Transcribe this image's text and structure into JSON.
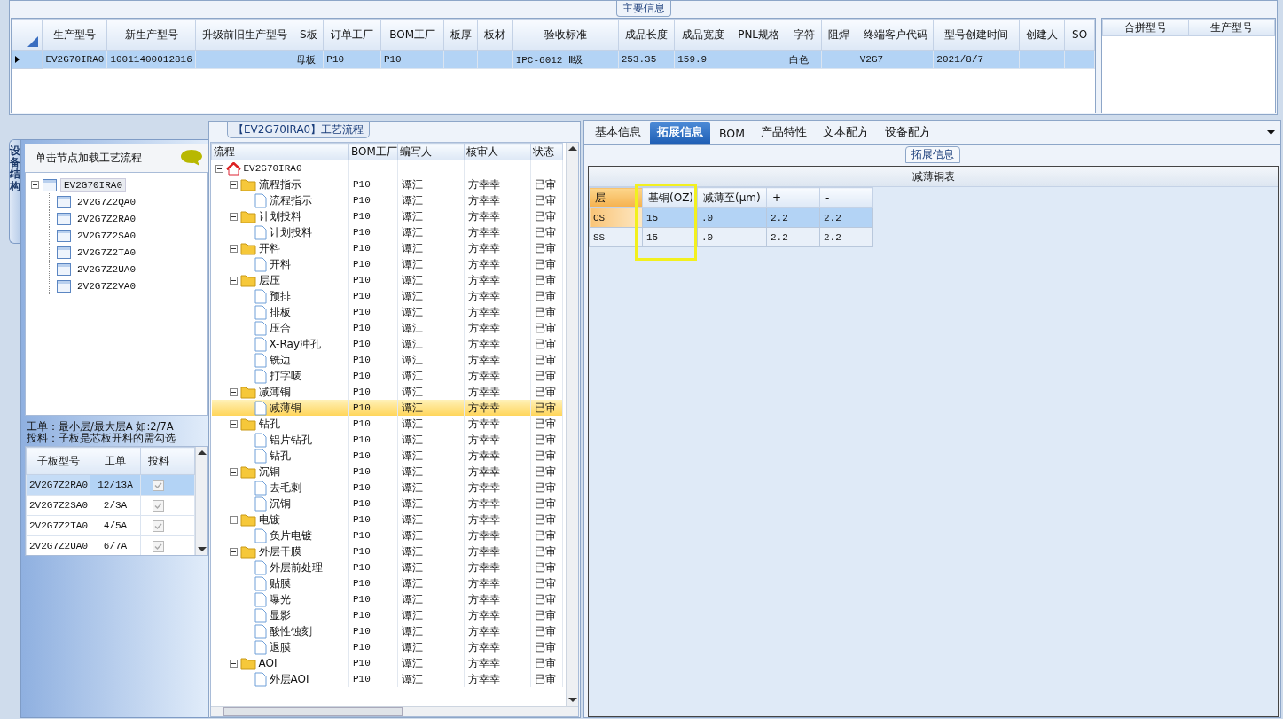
{
  "main_info": {
    "title": "主要信息",
    "columns": [
      "生产型号",
      "新生产型号",
      "升级前旧生产型号",
      "S板",
      "订单工厂",
      "BOM工厂",
      "板厚",
      "板材",
      "验收标准",
      "成品长度",
      "成品宽度",
      "PNL规格",
      "字符",
      "阻焊",
      "终端客户代码",
      "型号创建时间",
      "创建人",
      "SO"
    ],
    "rows": [
      {
        "selected": true,
        "cells": [
          "EV2G70IRA0",
          "10011400012816",
          null,
          "母板",
          "P10",
          "P10",
          null,
          null,
          "IPC-6012 Ⅱ级",
          "253.35",
          "159.9",
          null,
          "白色",
          null,
          "V2G7",
          "2021/8/7",
          null,
          null
        ]
      }
    ],
    "merge_columns": [
      "合拼型号",
      "生产型号"
    ]
  },
  "structure": {
    "tab_label": "设备结构",
    "hint": "单击节点加载工艺流程",
    "tree": {
      "label": "EV2G70IRA0",
      "selected": true,
      "expanded": true,
      "children": [
        {
          "label": "2V2G7Z2QA0",
          "selected": false
        },
        {
          "label": "2V2G7Z2RA0",
          "selected": false
        },
        {
          "label": "2V2G7Z2SA0",
          "selected": false
        },
        {
          "label": "2V2G7Z2TA0",
          "selected": false
        },
        {
          "label": "2V2G7Z2UA0",
          "selected": false
        },
        {
          "label": "2V2G7Z2VA0",
          "selected": false
        }
      ]
    },
    "notes": [
      "工单：最小层/最大层A 如:2/7A",
      "投料：子板是芯板开料的需勾选"
    ],
    "sub_columns": [
      "子板型号",
      "工单",
      "投料"
    ],
    "sub_rows": [
      {
        "model": "2V2G7Z2RA0",
        "order": "12/13A",
        "checked": true,
        "disabled": true,
        "selected": true
      },
      {
        "model": "2V2G7Z2SA0",
        "order": "2/3A",
        "checked": true,
        "disabled": true,
        "selected": false
      },
      {
        "model": "2V2G7Z2TA0",
        "order": "4/5A",
        "checked": true,
        "disabled": true,
        "selected": false
      },
      {
        "model": "2V2G7Z2UA0",
        "order": "6/7A",
        "checked": true,
        "disabled": true,
        "selected": false
      }
    ]
  },
  "flow": {
    "title": "【EV2G70IRA0】工艺流程",
    "columns": [
      "流程",
      "BOM工厂",
      "编写人",
      "核审人",
      "状态"
    ],
    "tree": {
      "label": "EV2G70IRA0",
      "kind": "root",
      "selected": false,
      "expanded": true,
      "children": [
        {
          "label": "流程指示",
          "kind": "folder",
          "bom": "P10",
          "writer": "谭江",
          "reviewer": "方幸幸",
          "status": "已审",
          "selected": false,
          "expanded": true,
          "children": [
            {
              "label": "流程指示",
              "kind": "step",
              "bom": "P10",
              "writer": "谭江",
              "reviewer": "方幸幸",
              "status": "已审",
              "selected": false
            }
          ]
        },
        {
          "label": "计划投料",
          "kind": "folder",
          "bom": "P10",
          "writer": "谭江",
          "reviewer": "方幸幸",
          "status": "已审",
          "selected": false,
          "expanded": true,
          "children": [
            {
              "label": "计划投料",
              "kind": "step",
              "bom": "P10",
              "writer": "谭江",
              "reviewer": "方幸幸",
              "status": "已审",
              "selected": false
            }
          ]
        },
        {
          "label": "开料",
          "kind": "folder",
          "bom": "P10",
          "writer": "谭江",
          "reviewer": "方幸幸",
          "status": "已审",
          "selected": false,
          "expanded": true,
          "children": [
            {
              "label": "开料",
              "kind": "step",
              "bom": "P10",
              "writer": "谭江",
              "reviewer": "方幸幸",
              "status": "已审",
              "selected": false
            }
          ]
        },
        {
          "label": "层压",
          "kind": "folder",
          "bom": "P10",
          "writer": "谭江",
          "reviewer": "方幸幸",
          "status": "已审",
          "selected": false,
          "expanded": true,
          "children": [
            {
              "label": "预排",
              "kind": "step",
              "bom": "P10",
              "writer": "谭江",
              "reviewer": "方幸幸",
              "status": "已审",
              "selected": false
            },
            {
              "label": "排板",
              "kind": "step",
              "bom": "P10",
              "writer": "谭江",
              "reviewer": "方幸幸",
              "status": "已审",
              "selected": false
            },
            {
              "label": "压合",
              "kind": "step",
              "bom": "P10",
              "writer": "谭江",
              "reviewer": "方幸幸",
              "status": "已审",
              "selected": false
            },
            {
              "label": "X-Ray冲孔",
              "kind": "step",
              "bom": "P10",
              "writer": "谭江",
              "reviewer": "方幸幸",
              "status": "已审",
              "selected": false
            },
            {
              "label": "铣边",
              "kind": "step",
              "bom": "P10",
              "writer": "谭江",
              "reviewer": "方幸幸",
              "status": "已审",
              "selected": false
            },
            {
              "label": "打字唛",
              "kind": "step",
              "bom": "P10",
              "writer": "谭江",
              "reviewer": "方幸幸",
              "status": "已审",
              "selected": false
            }
          ]
        },
        {
          "label": "减薄铜",
          "kind": "folder",
          "bom": "P10",
          "writer": "谭江",
          "reviewer": "方幸幸",
          "status": "已审",
          "selected": false,
          "expanded": true,
          "children": [
            {
              "label": "减薄铜",
              "kind": "step",
              "bom": "P10",
              "writer": "谭江",
              "reviewer": "方幸幸",
              "status": "已审",
              "selected": true
            }
          ]
        },
        {
          "label": "钻孔",
          "kind": "folder",
          "bom": "P10",
          "writer": "谭江",
          "reviewer": "方幸幸",
          "status": "已审",
          "selected": false,
          "expanded": true,
          "children": [
            {
              "label": "铝片钻孔",
              "kind": "step",
              "bom": "P10",
              "writer": "谭江",
              "reviewer": "方幸幸",
              "status": "已审",
              "selected": false
            },
            {
              "label": "钻孔",
              "kind": "step",
              "bom": "P10",
              "writer": "谭江",
              "reviewer": "方幸幸",
              "status": "已审",
              "selected": false
            }
          ]
        },
        {
          "label": "沉铜",
          "kind": "folder",
          "bom": "P10",
          "writer": "谭江",
          "reviewer": "方幸幸",
          "status": "已审",
          "selected": false,
          "expanded": true,
          "children": [
            {
              "label": "去毛刺",
              "kind": "step",
              "bom": "P10",
              "writer": "谭江",
              "reviewer": "方幸幸",
              "status": "已审",
              "selected": false
            },
            {
              "label": "沉铜",
              "kind": "step",
              "bom": "P10",
              "writer": "谭江",
              "reviewer": "方幸幸",
              "status": "已审",
              "selected": false
            }
          ]
        },
        {
          "label": "电镀",
          "kind": "folder",
          "bom": "P10",
          "writer": "谭江",
          "reviewer": "方幸幸",
          "status": "已审",
          "selected": false,
          "expanded": true,
          "children": [
            {
              "label": "负片电镀",
              "kind": "step",
              "bom": "P10",
              "writer": "谭江",
              "reviewer": "方幸幸",
              "status": "已审",
              "selected": false
            }
          ]
        },
        {
          "label": "外层干膜",
          "kind": "folder",
          "bom": "P10",
          "writer": "谭江",
          "reviewer": "方幸幸",
          "status": "已审",
          "selected": false,
          "expanded": true,
          "children": [
            {
              "label": "外层前处理",
              "kind": "step",
              "bom": "P10",
              "writer": "谭江",
              "reviewer": "方幸幸",
              "status": "已审",
              "selected": false
            },
            {
              "label": "贴膜",
              "kind": "step",
              "bom": "P10",
              "writer": "谭江",
              "reviewer": "方幸幸",
              "status": "已审",
              "selected": false
            },
            {
              "label": "曝光",
              "kind": "step",
              "bom": "P10",
              "writer": "谭江",
              "reviewer": "方幸幸",
              "status": "已审",
              "selected": false
            },
            {
              "label": "显影",
              "kind": "step",
              "bom": "P10",
              "writer": "谭江",
              "reviewer": "方幸幸",
              "status": "已审",
              "selected": false
            },
            {
              "label": "酸性蚀刻",
              "kind": "step",
              "bom": "P10",
              "writer": "谭江",
              "reviewer": "方幸幸",
              "status": "已审",
              "selected": false
            },
            {
              "label": "退膜",
              "kind": "step",
              "bom": "P10",
              "writer": "谭江",
              "reviewer": "方幸幸",
              "status": "已审",
              "selected": false
            }
          ]
        },
        {
          "label": "AOI",
          "kind": "folder",
          "bom": "P10",
          "writer": "谭江",
          "reviewer": "方幸幸",
          "status": "已审",
          "selected": false,
          "expanded": true,
          "children": [
            {
              "label": "外层AOI",
              "kind": "step",
              "bom": "P10",
              "writer": "谭江",
              "reviewer": "方幸幸",
              "status": "已审",
              "selected": false
            }
          ]
        }
      ]
    }
  },
  "detail": {
    "tabs": [
      {
        "label": "基本信息",
        "selected": false
      },
      {
        "label": "拓展信息",
        "selected": true
      },
      {
        "label": "BOM",
        "selected": false
      },
      {
        "label": "产品特性",
        "selected": false
      },
      {
        "label": "文本配方",
        "selected": false
      },
      {
        "label": "设备配方",
        "selected": false
      }
    ],
    "group_title": "拓展信息",
    "table_title": "减薄铜表",
    "columns": [
      {
        "label": "层",
        "highlighted": false
      },
      {
        "label": "基铜(OZ)",
        "highlighted": true
      },
      {
        "label": "减薄至(μm)",
        "highlighted": false
      },
      {
        "label": "+",
        "highlighted": false
      },
      {
        "label": "-",
        "highlighted": false
      }
    ],
    "rows": [
      {
        "selected": true,
        "cells": [
          "CS",
          "15",
          ".0",
          "2.2",
          "2.2"
        ]
      },
      {
        "selected": false,
        "cells": [
          "SS",
          "15",
          ".0",
          "2.2",
          "2.2"
        ]
      }
    ]
  }
}
